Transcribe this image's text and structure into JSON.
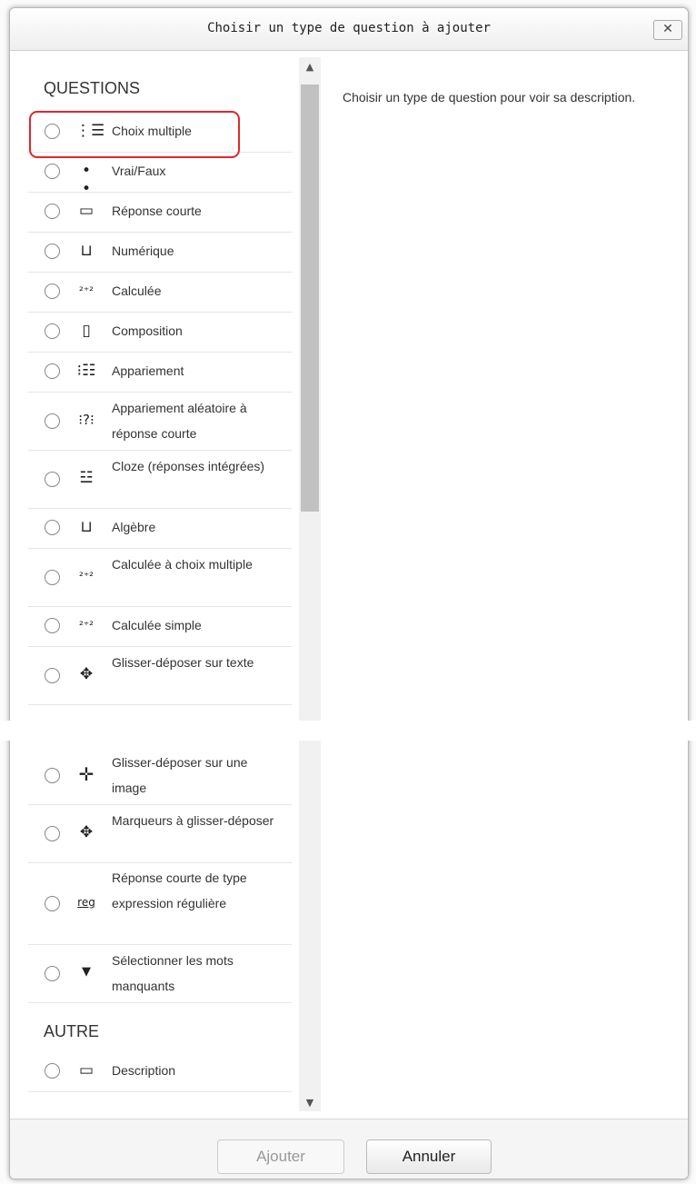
{
  "dialog": {
    "title": "Choisir un type de question à ajouter",
    "close_label": "✕"
  },
  "sections": {
    "questions": "QUESTIONS",
    "other": "AUTRE"
  },
  "options": [
    {
      "label": "Choix multiple",
      "icon": "multichoice-icon",
      "glyph": "⋮☰"
    },
    {
      "label": "Vrai/Faux",
      "icon": "truefalse-icon",
      "glyph": "• •"
    },
    {
      "label": "Réponse courte",
      "icon": "shortanswer-icon",
      "glyph": "▭"
    },
    {
      "label": "Numérique",
      "icon": "numerical-icon",
      "glyph": "⊔"
    },
    {
      "label": "Calculée",
      "icon": "calculated-icon",
      "glyph": "²⁺²"
    },
    {
      "label": "Composition",
      "icon": "essay-icon",
      "glyph": "▯"
    },
    {
      "label": "Appariement",
      "icon": "match-icon",
      "glyph": "⁝☷"
    },
    {
      "label": "Appariement aléatoire à réponse courte",
      "icon": "randomsamatch-icon",
      "glyph": "⁝?⁝"
    },
    {
      "label": "Cloze (réponses intégrées)",
      "icon": "multianswer-icon",
      "glyph": "☳"
    },
    {
      "label": "Algèbre",
      "icon": "algebra-icon",
      "glyph": "⊔"
    },
    {
      "label": "Calculée à choix multiple",
      "icon": "calculatedmulti-icon",
      "glyph": "²⁺²"
    },
    {
      "label": "Calculée simple",
      "icon": "calculatedsimple-icon",
      "glyph": "²⁺²"
    },
    {
      "label": "Glisser-déposer sur texte",
      "icon": "ddwtos-icon",
      "glyph": "✥"
    },
    {
      "label": "Glisser-déposer sur une image",
      "icon": "ddimageortext-icon",
      "glyph": "✛"
    },
    {
      "label": "Marqueurs à glisser-déposer",
      "icon": "ddmarker-icon",
      "glyph": "✥"
    },
    {
      "label": "Réponse courte de type expression régulière",
      "icon": "regexp-icon",
      "glyph": "reg"
    },
    {
      "label": "Sélectionner les mots manquants",
      "icon": "gapselect-icon",
      "glyph": "▼"
    },
    {
      "label": "Description",
      "icon": "description-icon",
      "glyph": "▭"
    }
  ],
  "description": "Choisir un type de question pour voir sa description.",
  "buttons": {
    "add": "Ajouter",
    "cancel": "Annuler"
  }
}
